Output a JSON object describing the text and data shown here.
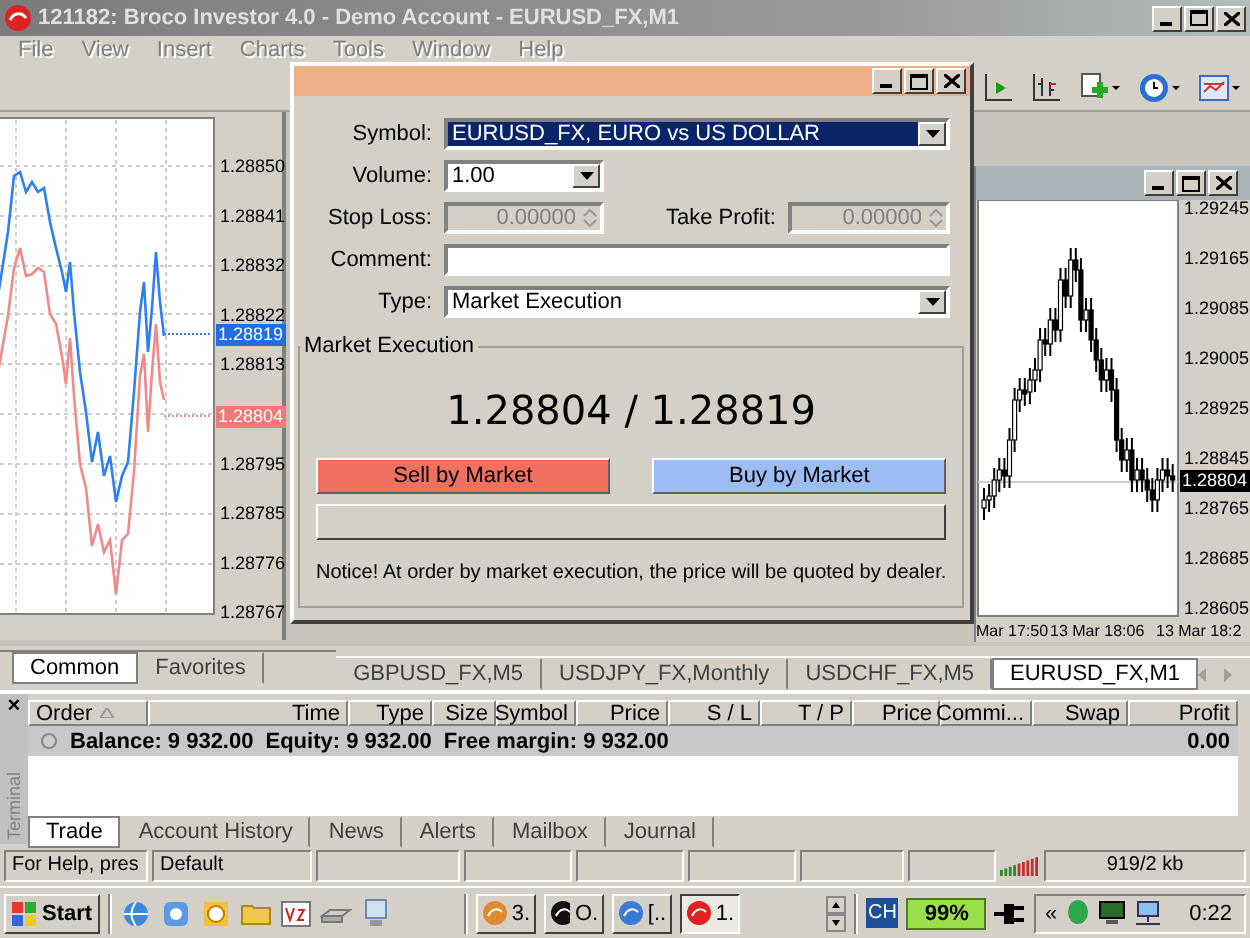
{
  "window": {
    "title": "121182: Broco Investor 4.0 - Demo Account - EURUSD_FX,M1"
  },
  "menu": [
    {
      "label": "File",
      "disabled": true
    },
    {
      "label": "View",
      "disabled": true
    },
    {
      "label": "Insert",
      "disabled": true
    },
    {
      "label": "Charts",
      "disabled": true
    },
    {
      "label": "Tools",
      "disabled": true
    },
    {
      "label": "Window",
      "disabled": true
    },
    {
      "label": "Help",
      "disabled": true
    }
  ],
  "tick_chart": {
    "price_labels": [
      "1.28850",
      "1.28841",
      "1.28832",
      "1.28822",
      "1.28813",
      "1.28795",
      "1.28785",
      "1.28776",
      "1.28767"
    ],
    "markers": [
      {
        "label": "1.28819",
        "color": "#1e6ee6"
      },
      {
        "label": "1.28804",
        "color": "#f07878"
      }
    ]
  },
  "price_chart": {
    "price_labels": [
      "1.29245",
      "1.29165",
      "1.29085",
      "1.29005",
      "1.28925",
      "1.28845",
      "1.28765",
      "1.28685",
      "1.28605"
    ],
    "marker": "1.28804",
    "time_labels": [
      "Mar 17:50",
      "13 Mar 18:06",
      "13 Mar 18:2"
    ]
  },
  "order_dialog": {
    "symbol_label": "Symbol:",
    "symbol": "EURUSD_FX, EURO vs US DOLLAR",
    "volume_label": "Volume:",
    "volume": "1.00",
    "stop_loss_label": "Stop Loss:",
    "stop_loss": "0.00000",
    "take_profit_label": "Take Profit:",
    "take_profit": "0.00000",
    "stops_disabled": true,
    "comment_label": "Comment:",
    "type_label": "Type:",
    "type": "Market Execution",
    "group_title": "Market Execution",
    "quote": "1.28804 / 1.28819",
    "sell_button": "Sell by Market",
    "buy_button": "Buy by Market",
    "notice": "Notice! At order by market execution, the price will be quoted by dealer."
  },
  "market_watch_tabs": [
    {
      "label": "Common",
      "selected": true
    },
    {
      "label": "Favorites",
      "selected": false
    }
  ],
  "chart_tabs": [
    {
      "label": "GBPUSD_FX,M5",
      "selected": false
    },
    {
      "label": "USDJPY_FX,Monthly",
      "selected": false
    },
    {
      "label": "USDCHF_FX,M5",
      "selected": false
    },
    {
      "label": "EURUSD_FX,M1",
      "selected": true
    }
  ],
  "terminal": {
    "close": "×",
    "side_label": "Terminal",
    "columns": [
      "Order",
      "Time",
      "Type",
      "Size",
      "Symbol",
      "Price",
      "S / L",
      "T / P",
      "Price",
      "Commi...",
      "Swap",
      "Profit"
    ],
    "rows": [
      {
        "parts": [
          "Balance: 9 932.00",
          "Equity: 9 932.00",
          "Free margin: 9 932.00"
        ],
        "profit": "0.00"
      }
    ],
    "tabs": [
      {
        "label": "Trade",
        "selected": true
      },
      {
        "label": "Account History",
        "selected": false
      },
      {
        "label": "News",
        "selected": false
      },
      {
        "label": "Alerts",
        "selected": false
      },
      {
        "label": "Mailbox",
        "selected": false
      },
      {
        "label": "Journal",
        "selected": false
      }
    ]
  },
  "status_bar": {
    "help": "For Help, pres",
    "profile": "Default",
    "traffic": "919/2 kb"
  },
  "taskbar": {
    "start": "Start",
    "tasks": [
      {
        "label": "3.",
        "selected": false
      },
      {
        "label": "O.",
        "selected": false
      },
      {
        "label": "[..",
        "selected": false
      },
      {
        "label": "1.",
        "selected": true
      }
    ],
    "language": "CH",
    "battery": "99%",
    "tray_expand": "«",
    "clock": "0:22"
  }
}
